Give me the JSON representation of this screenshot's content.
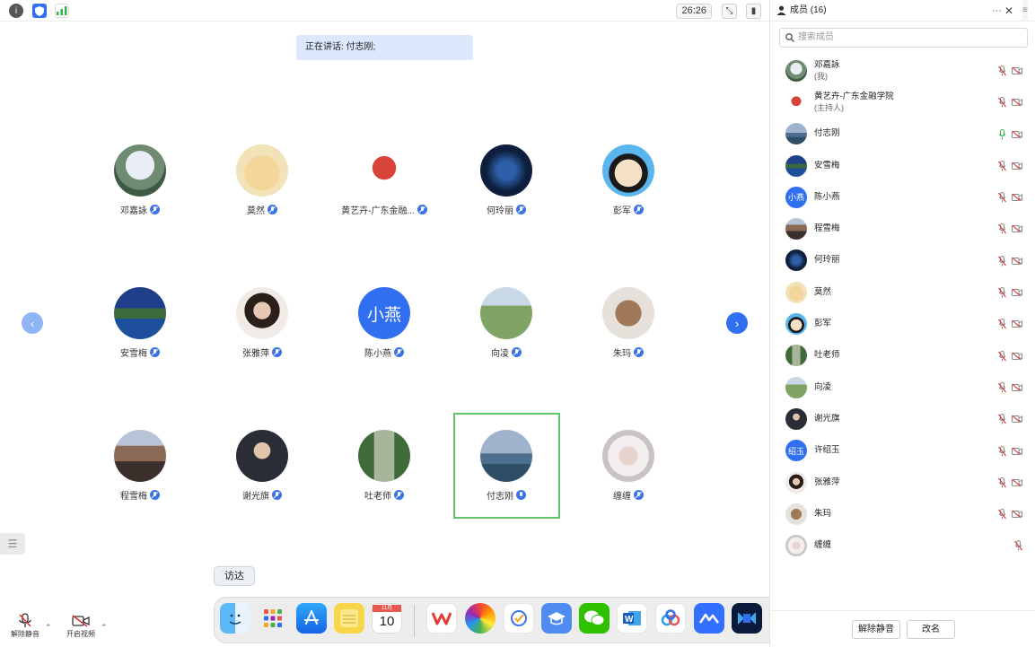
{
  "topbar": {
    "timer": "26:26",
    "icons": [
      "info-icon",
      "shield-icon",
      "signal-icon"
    ]
  },
  "speaking": "正在讲话: 付志刚;",
  "grid": {
    "tiles": [
      {
        "name": "邓嘉詠",
        "mic": "on"
      },
      {
        "name": "莫然",
        "mic": "on"
      },
      {
        "name": "黄艺卉-广东金融...",
        "mic": "on"
      },
      {
        "name": "何玲丽",
        "mic": "on"
      },
      {
        "name": "彭军",
        "mic": "on"
      },
      {
        "name": "安雪梅",
        "mic": "on"
      },
      {
        "name": "张雅萍",
        "mic": "on"
      },
      {
        "name": "陈小燕",
        "mic": "on",
        "initials": "小燕"
      },
      {
        "name": "向凌",
        "mic": "on"
      },
      {
        "name": "朱玛",
        "mic": "on"
      },
      {
        "name": "程雪梅",
        "mic": "on"
      },
      {
        "name": "谢光旗",
        "mic": "on"
      },
      {
        "name": "吐老师",
        "mic": "on"
      },
      {
        "name": "付志刚",
        "mic": "active"
      },
      {
        "name": "缠缠",
        "mic": "on"
      }
    ]
  },
  "controls": {
    "unmute": "解除静音",
    "start_video": "开启视频"
  },
  "dock": {
    "tooltip": "访达",
    "calendar_month": "11月",
    "calendar_day": "10",
    "apps": [
      "finder-icon",
      "launchpad-icon",
      "app-store-icon",
      "notes-icon",
      "calendar-icon",
      "wps-icon",
      "photos-icon",
      "tasks-icon",
      "classroom-icon",
      "wechat-icon",
      "word-icon",
      "baidu-netdisk-icon",
      "lark-icon",
      "voov-icon",
      "trash-icon"
    ]
  },
  "sidebar": {
    "title": "成员 (16)",
    "search_placeholder": "搜索成员",
    "members": [
      {
        "name": "邓嘉詠",
        "sub": "(我)"
      },
      {
        "name": "黄艺卉-广东金融学院",
        "sub": "(主持人)"
      },
      {
        "name": "付志刚",
        "sub": "",
        "speaking": true
      },
      {
        "name": "安雪梅",
        "sub": ""
      },
      {
        "name": "陈小燕",
        "sub": "",
        "initials": "小燕"
      },
      {
        "name": "程雪梅",
        "sub": ""
      },
      {
        "name": "何玲丽",
        "sub": ""
      },
      {
        "name": "莫然",
        "sub": ""
      },
      {
        "name": "彭军",
        "sub": ""
      },
      {
        "name": "吐老师",
        "sub": ""
      },
      {
        "name": "向凌",
        "sub": ""
      },
      {
        "name": "谢光旗",
        "sub": ""
      },
      {
        "name": "许绍玉",
        "sub": "",
        "initials": "绍玉"
      },
      {
        "name": "张雅萍",
        "sub": ""
      },
      {
        "name": "朱玛",
        "sub": ""
      },
      {
        "name": "缠缠",
        "sub": "",
        "no_camera": true
      }
    ],
    "mute_all": "解除静音",
    "rename": "改名"
  },
  "colors": {
    "accent": "#2f6ff0",
    "highlight": "#5fc46a",
    "speaking_bg": "#dce8fb"
  }
}
